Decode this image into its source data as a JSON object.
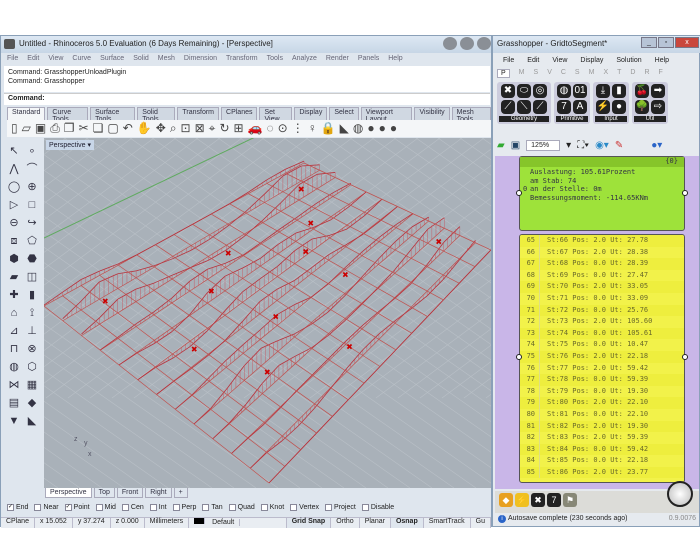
{
  "rhino": {
    "title": "Untitled - Rhinoceros 5.0 Evaluation (6 Days Remaining) - [Perspective]",
    "menu": [
      "File",
      "Edit",
      "View",
      "Curve",
      "Surface",
      "Solid",
      "Mesh",
      "Dimension",
      "Transform",
      "Tools",
      "Analyze",
      "Render",
      "Panels",
      "Help"
    ],
    "command_history": [
      "Command: GrasshopperUnloadPlugin",
      "Command: Grasshopper"
    ],
    "command_prompt": "Command:",
    "toolbar_tabs": [
      "Standard",
      "Curve Tools",
      "Surface Tools",
      "Solid Tools",
      "Transform",
      "CPlanes",
      "Set View",
      "Display",
      "Select",
      "Viewport Layout",
      "Visibility",
      "Mesh Tools"
    ],
    "toolbar_icons": [
      "new-icon",
      "open-icon",
      "save-icon",
      "print-icon",
      "import-icon",
      "cut-icon",
      "copy-icon",
      "paste-icon",
      "undo-icon",
      "pan-icon",
      "rotate-icon",
      "zoom-icon",
      "zoom-window-icon",
      "zoom-extents-icon",
      "zoom-selected-icon",
      "rotate-view-icon",
      "viewport-layout-icon",
      "car-icon",
      "hide-icon",
      "show-icon",
      "points-icon",
      "light-icon",
      "lock-icon",
      "layer-icon",
      "color-wheel-icon",
      "render-sphere-icon",
      "shaded-sphere-icon",
      "blue-sphere-icon"
    ],
    "viewport_title": "Perspective",
    "viewport_tabs": [
      "Perspective",
      "Top",
      "Front",
      "Right",
      "+"
    ],
    "osnaps": [
      {
        "label": "End",
        "checked": true
      },
      {
        "label": "Near",
        "checked": false
      },
      {
        "label": "Point",
        "checked": true
      },
      {
        "label": "Mid",
        "checked": false
      },
      {
        "label": "Cen",
        "checked": false
      },
      {
        "label": "Int",
        "checked": false
      },
      {
        "label": "Perp",
        "checked": false
      },
      {
        "label": "Tan",
        "checked": false
      },
      {
        "label": "Quad",
        "checked": false
      },
      {
        "label": "Knot",
        "checked": false
      },
      {
        "label": "Vertex",
        "checked": false
      },
      {
        "label": "Project",
        "checked": false
      },
      {
        "label": "Disable",
        "checked": false
      }
    ],
    "status": {
      "cplane": "CPlane",
      "x": "x 15.052",
      "y": "y 37.274",
      "z": "z 0.000",
      "units": "Millimeters",
      "layer": "Default",
      "grid_snap": "Grid Snap",
      "ortho": "Ortho",
      "planar": "Planar",
      "osnap": "Osnap",
      "smarttrack": "SmartTrack",
      "gumball": "Gu"
    },
    "axis_labels": {
      "z": "z",
      "y": "y",
      "x": "x"
    }
  },
  "grasshopper": {
    "title": "Grasshopper - GridtoSegment*",
    "menu": [
      "File",
      "Edit",
      "View",
      "Display",
      "Solution",
      "Help"
    ],
    "tabs": [
      "P",
      "M",
      "S",
      "V",
      "C",
      "S",
      "M",
      "X",
      "T",
      "D",
      "R",
      "F"
    ],
    "groups": [
      {
        "label": "Geometry",
        "icons": [
          "✖",
          "⬭",
          "◎",
          "⟋",
          "⟍",
          "⟋"
        ]
      },
      {
        "label": "Primitive",
        "icons": [
          "◍",
          "01",
          "7",
          "A"
        ]
      },
      {
        "label": "Input",
        "icons": [
          "⤓",
          "▮",
          "⚡",
          "●"
        ]
      },
      {
        "label": "Util",
        "icons": [
          "🍒",
          "➡",
          "🌳",
          "⇨"
        ]
      }
    ],
    "zoom": "125%",
    "panel_header": "{0}",
    "panel_index": "0",
    "panel_lines": [
      "Auslastung: 105.61Prozent",
      "am Stab: 74",
      "an der Stelle: 0m",
      "Bemessungsmoment: -114.65KNm"
    ],
    "list_rows": [
      {
        "i": "65",
        "t": "St:66 Pos: 2.0 Ut: 27.78"
      },
      {
        "i": "66",
        "t": "St:67 Pos: 2.0 Ut: 28.38"
      },
      {
        "i": "67",
        "t": "St:68 Pos: 0.0 Ut: 28.39"
      },
      {
        "i": "68",
        "t": "St:69 Pos: 0.0 Ut: 27.47"
      },
      {
        "i": "69",
        "t": "St:70 Pos: 2.0 Ut: 33.05"
      },
      {
        "i": "70",
        "t": "St:71 Pos: 0.0 Ut: 33.09"
      },
      {
        "i": "71",
        "t": "St:72 Pos: 0.0 Ut: 25.76"
      },
      {
        "i": "72",
        "t": "St:73 Pos: 2.0 Ut: 105.60"
      },
      {
        "i": "73",
        "t": "St:74 Pos: 0.0 Ut: 105.61"
      },
      {
        "i": "74",
        "t": "St:75 Pos: 0.0 Ut: 10.47"
      },
      {
        "i": "75",
        "t": "St:76 Pos: 2.0 Ut: 22.18"
      },
      {
        "i": "76",
        "t": "St:77 Pos: 2.0 Ut: 59.42"
      },
      {
        "i": "77",
        "t": "St:78 Pos: 0.0 Ut: 59.39"
      },
      {
        "i": "78",
        "t": "St:79 Pos: 0.0 Ut: 19.30"
      },
      {
        "i": "79",
        "t": "St:80 Pos: 2.0 Ut: 22.10"
      },
      {
        "i": "80",
        "t": "St:81 Pos: 0.0 Ut: 22.10"
      },
      {
        "i": "81",
        "t": "St:82 Pos: 2.0 Ut: 19.30"
      },
      {
        "i": "82",
        "t": "St:83 Pos: 2.0 Ut: 59.39"
      },
      {
        "i": "83",
        "t": "St:84 Pos: 0.0 Ut: 59.42"
      },
      {
        "i": "84",
        "t": "St:85 Pos: 0.0 Ut: 22.18"
      },
      {
        "i": "85",
        "t": "St:86 Pos: 2.0 Ut: 23.77"
      }
    ],
    "status": "Autosave complete (230 seconds ago)",
    "version": "0.9.0076"
  }
}
